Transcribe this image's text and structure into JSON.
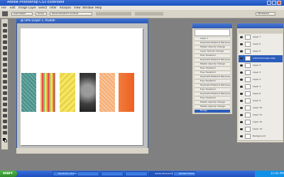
{
  "app": {
    "title": "Adobe Photoshop CS3 Extended"
  },
  "menu": {
    "items": [
      "File",
      "Edit",
      "Image",
      "Layer",
      "Select",
      "Filter",
      "Analysis",
      "View",
      "Window",
      "Help"
    ]
  },
  "options_bar": {
    "auto_select_label": "Auto-Select",
    "group_label": "Group",
    "show_transform_controls_label": "Show Transform Controls",
    "workspace_label": "Workspace"
  },
  "document": {
    "title": "@ 50% (Layer 1, RGB/8)",
    "canvas_bg": "#ffffff",
    "thumbnails": [
      {
        "name": "teal-dot-paper",
        "color": "#5fa8a0"
      },
      {
        "name": "striped-paper",
        "color": "#f0c040"
      },
      {
        "name": "yellow-diamond-paper",
        "color": "#f4e050"
      },
      {
        "name": "photo-child",
        "color": "#505050"
      },
      {
        "name": "peach-pattern-paper",
        "color": "#f8c090"
      },
      {
        "name": "orange-paper",
        "color": "#f07030"
      }
    ]
  },
  "history": {
    "rows": [
      "Layer 1",
      "Duplicate Elliptical Marquee",
      "Master Opacity Change",
      "Layer Opacity Change",
      "Free Transform",
      "Duplicate Elliptical Marquee",
      "Master Opacity Change",
      "Free Transform",
      "Free Transform",
      "Duplicate Elliptical Marquee",
      "Free Transform",
      "Duplicate Elliptical Marquee",
      "Free Transform",
      "Duplicate Elliptical Marquee",
      "Free Transform",
      "Master Opacity Change",
      "Master Opacity Change",
      "Nudge"
    ],
    "active_row": "Nudge"
  },
  "layers": {
    "rows": [
      "Layer 7",
      "Layer 6",
      "Layer 5",
      "shadows/image edge",
      "Layer 4",
      "Layer 3",
      "Layer 2",
      "Layer 1",
      "Layer 8",
      "Layer 9",
      "Layer 10",
      "Layer 11",
      "Layer 12",
      "Layer 13",
      "Background"
    ],
    "active_row": "shadows/image edge"
  },
  "taskbar": {
    "start_label": "start",
    "items": [
      "Facebook | Home",
      "",
      "",
      "",
      "Adobe Photoshop C...",
      "Mozilla Firefox..."
    ],
    "clock": "11:05 PM"
  }
}
